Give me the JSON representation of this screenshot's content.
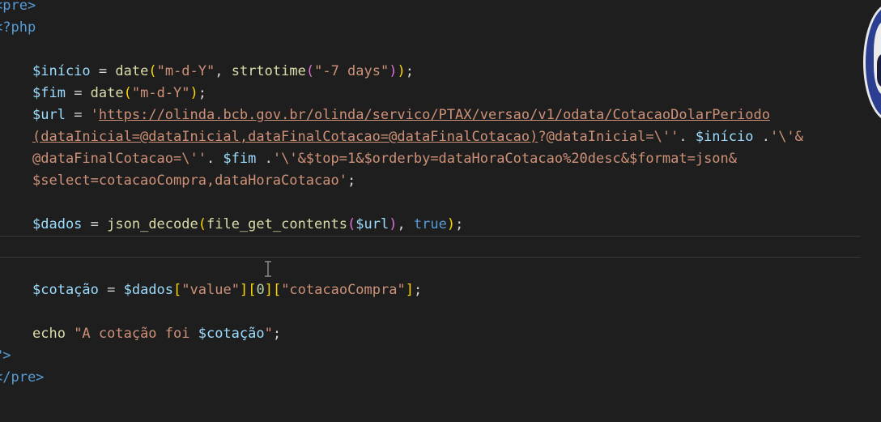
{
  "editor": {
    "lines": [
      {
        "indent": false,
        "current": false,
        "tokens": [
          {
            "t": "<pre>",
            "c": "kw"
          }
        ]
      },
      {
        "indent": false,
        "current": false,
        "tokens": [
          {
            "t": "<?php",
            "c": "kw"
          }
        ]
      },
      {
        "indent": false,
        "current": false,
        "tokens": []
      },
      {
        "indent": true,
        "current": false,
        "tokens": [
          {
            "t": "$início",
            "c": "var"
          },
          {
            "t": " = ",
            "c": ""
          },
          {
            "t": "date",
            "c": "fn"
          },
          {
            "t": "(",
            "c": "p1"
          },
          {
            "t": "\"m-d-Y\"",
            "c": "str"
          },
          {
            "t": ", ",
            "c": ""
          },
          {
            "t": "strtotime",
            "c": "fn"
          },
          {
            "t": "(",
            "c": "p2"
          },
          {
            "t": "\"-7 days\"",
            "c": "str"
          },
          {
            "t": ")",
            "c": "p2"
          },
          {
            "t": ")",
            "c": "p1"
          },
          {
            "t": ";",
            "c": ""
          }
        ]
      },
      {
        "indent": true,
        "current": false,
        "tokens": [
          {
            "t": "$fim",
            "c": "var"
          },
          {
            "t": " = ",
            "c": ""
          },
          {
            "t": "date",
            "c": "fn"
          },
          {
            "t": "(",
            "c": "p1"
          },
          {
            "t": "\"m-d-Y\"",
            "c": "str"
          },
          {
            "t": ")",
            "c": "p1"
          },
          {
            "t": ";",
            "c": ""
          }
        ]
      },
      {
        "indent": true,
        "current": false,
        "tokens": [
          {
            "t": "$url",
            "c": "var"
          },
          {
            "t": " = ",
            "c": ""
          },
          {
            "t": "'",
            "c": "str"
          },
          {
            "t": "https://olinda.bcb.gov.br/olinda/servico/PTAX/versao/v1/odata/CotacaoDolarPeriodo",
            "c": "str url"
          }
        ]
      },
      {
        "indent": true,
        "current": false,
        "tokens": [
          {
            "t": "(dataInicial=@dataInicial,dataFinalCotacao=@dataFinalCotacao)",
            "c": "str url"
          },
          {
            "t": "?@dataInicial=\\''",
            "c": "str"
          },
          {
            "t": ". ",
            "c": ""
          },
          {
            "t": "$início",
            "c": "var"
          },
          {
            "t": " .",
            "c": ""
          },
          {
            "t": "'\\'&",
            "c": "str"
          }
        ]
      },
      {
        "indent": true,
        "current": false,
        "tokens": [
          {
            "t": "@dataFinalCotacao=\\''",
            "c": "str"
          },
          {
            "t": ". ",
            "c": ""
          },
          {
            "t": "$fim",
            "c": "var"
          },
          {
            "t": " .",
            "c": ""
          },
          {
            "t": "'\\'&$top=1&$orderby=dataHoraCotacao%20desc&$format=json&",
            "c": "str"
          }
        ]
      },
      {
        "indent": true,
        "current": false,
        "tokens": [
          {
            "t": "$select=cotacaoCompra,dataHoraCotacao'",
            "c": "str"
          },
          {
            "t": ";",
            "c": ""
          }
        ]
      },
      {
        "indent": false,
        "current": false,
        "tokens": []
      },
      {
        "indent": true,
        "current": false,
        "tokens": [
          {
            "t": "$dados",
            "c": "var"
          },
          {
            "t": " = ",
            "c": ""
          },
          {
            "t": "json_decode",
            "c": "fn"
          },
          {
            "t": "(",
            "c": "p1"
          },
          {
            "t": "file_get_contents",
            "c": "fn"
          },
          {
            "t": "(",
            "c": "p2"
          },
          {
            "t": "$url",
            "c": "var"
          },
          {
            "t": ")",
            "c": "p2"
          },
          {
            "t": ", ",
            "c": ""
          },
          {
            "t": "true",
            "c": "kw"
          },
          {
            "t": ")",
            "c": "p1"
          },
          {
            "t": ";",
            "c": ""
          }
        ]
      },
      {
        "indent": false,
        "current": true,
        "tokens": []
      },
      {
        "indent": false,
        "current": false,
        "tokens": []
      },
      {
        "indent": true,
        "current": false,
        "tokens": [
          {
            "t": "$cotação",
            "c": "var"
          },
          {
            "t": " = ",
            "c": ""
          },
          {
            "t": "$dados",
            "c": "var"
          },
          {
            "t": "[",
            "c": "p1"
          },
          {
            "t": "\"value\"",
            "c": "str"
          },
          {
            "t": "]",
            "c": "p1"
          },
          {
            "t": "[",
            "c": "p1"
          },
          {
            "t": "0",
            "c": "num"
          },
          {
            "t": "]",
            "c": "p1"
          },
          {
            "t": "[",
            "c": "p1"
          },
          {
            "t": "\"cotacaoCompra\"",
            "c": "str"
          },
          {
            "t": "]",
            "c": "p1"
          },
          {
            "t": ";",
            "c": ""
          }
        ]
      },
      {
        "indent": false,
        "current": false,
        "tokens": []
      },
      {
        "indent": true,
        "current": false,
        "tokens": [
          {
            "t": "echo ",
            "c": "fn"
          },
          {
            "t": "\"A cotação foi ",
            "c": "str"
          },
          {
            "t": "$cotação",
            "c": "var"
          },
          {
            "t": "\"",
            "c": "str"
          },
          {
            "t": ";",
            "c": ""
          }
        ]
      },
      {
        "indent": false,
        "current": false,
        "tokens": [
          {
            "t": "?>",
            "c": "kw"
          }
        ]
      },
      {
        "indent": false,
        "current": false,
        "tokens": [
          {
            "t": "</pre>",
            "c": "kw"
          }
        ]
      }
    ]
  },
  "colors": {
    "background": "#1e1e1e",
    "keyword": "#569cd6",
    "variable": "#9cdcfe",
    "function": "#dcdcaa",
    "string": "#ce9178",
    "number": "#b5cea8",
    "bracket1": "#ffd700",
    "bracket2": "#da70d6"
  },
  "icons": {
    "text_cursor": "i-beam-cursor-icon",
    "webcam": "presenter-avatar"
  }
}
